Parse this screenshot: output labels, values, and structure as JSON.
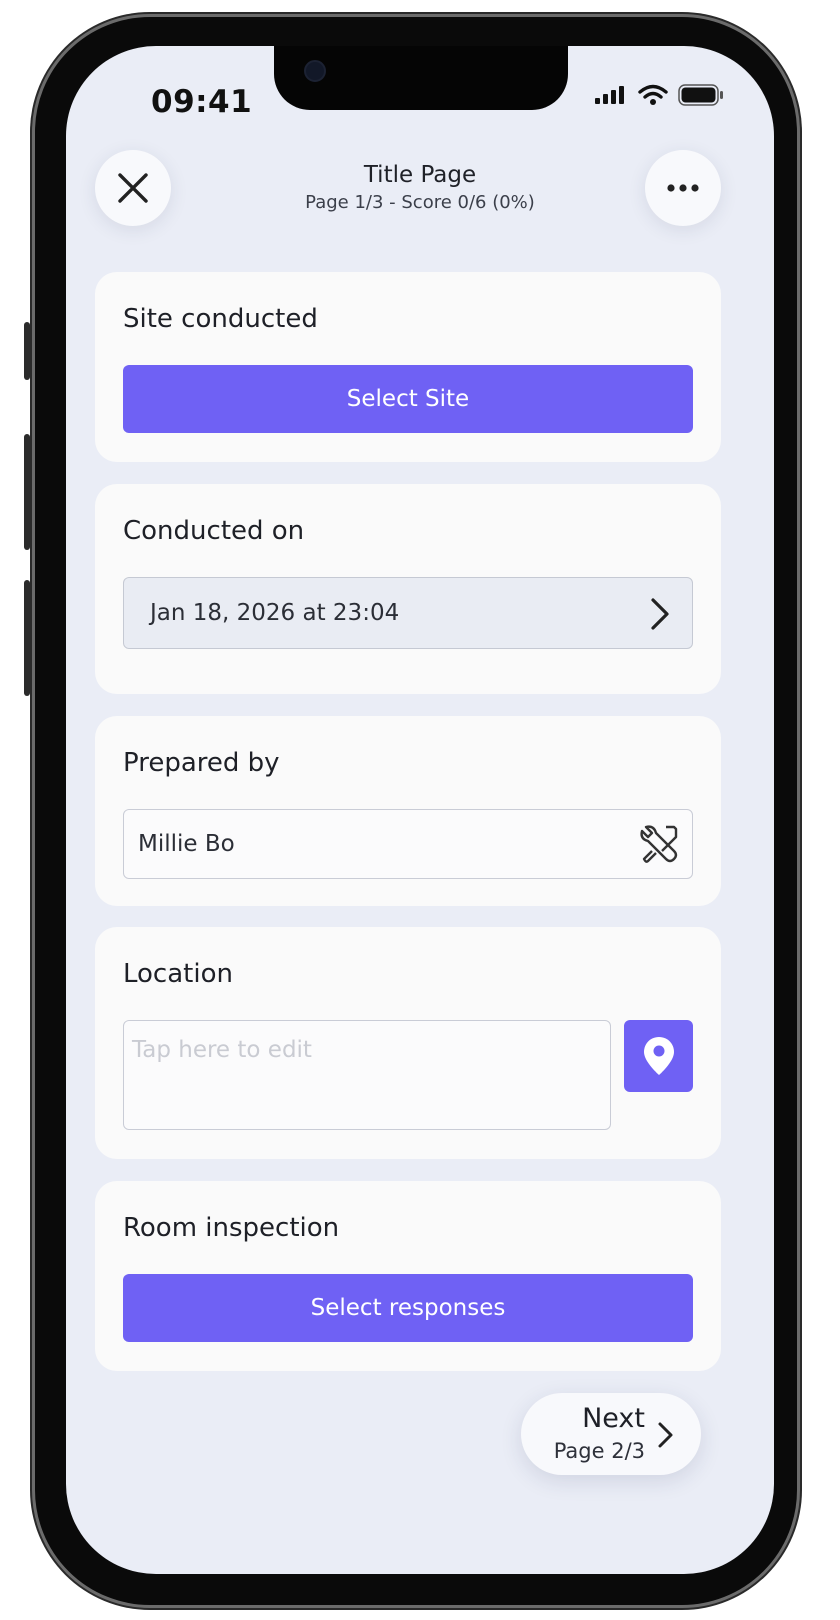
{
  "status_bar": {
    "time": "09:41"
  },
  "header": {
    "title": "Title Page",
    "subtitle": "Page 1/3 - Score 0/6 (0%)"
  },
  "icons": {
    "close": "close-icon",
    "more": "more-horizontal-icon",
    "chevron": "chevron-right-icon",
    "tools": "tools-icon",
    "location": "location-pin-icon"
  },
  "colors": {
    "accent": "#6f61f4",
    "background": "#eaedf6",
    "card": "#fafafa"
  },
  "cards": {
    "site": {
      "label": "Site conducted",
      "button": "Select Site"
    },
    "conducted": {
      "label": "Conducted on",
      "value": "Jan 18, 2026 at 23:04"
    },
    "prepared": {
      "label": "Prepared by",
      "value": "Millie Bo"
    },
    "location": {
      "label": "Location",
      "placeholder": "Tap here to edit"
    },
    "room": {
      "label": "Room inspection",
      "button": "Select responses"
    }
  },
  "footer": {
    "next_label": "Next",
    "next_page": "Page 2/3"
  }
}
